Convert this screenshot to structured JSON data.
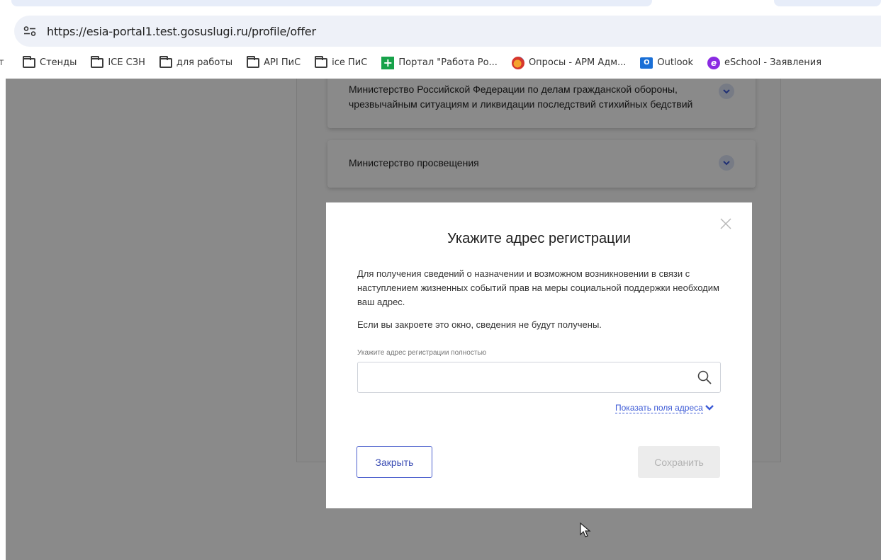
{
  "browser": {
    "url": "https://esia-portal1.test.gosuslugi.ru/profile/offer",
    "site_info_icon": "tune-icon",
    "bookmarks": [
      {
        "label": "Стенды",
        "icon": "folder-icon"
      },
      {
        "label": "ICE СЗН",
        "icon": "folder-icon"
      },
      {
        "label": "для работы",
        "icon": "folder-icon"
      },
      {
        "label": "API ПиС",
        "icon": "folder-icon"
      },
      {
        "label": "ice ПиС",
        "icon": "folder-icon"
      },
      {
        "label": "Портал \"Работа Ро...",
        "icon": "plus-favicon-icon"
      },
      {
        "label": "Опросы - АРМ Адм...",
        "icon": "poll-favicon-icon"
      },
      {
        "label": "Outlook",
        "icon": "outlook-icon"
      },
      {
        "label": "eSchool - Заявления",
        "icon": "eschool-icon"
      }
    ]
  },
  "page": {
    "accordion": [
      {
        "label": "Министерство Российской Федерации по делам гражданской обороны, чрезвычайным ситуациям и ликвидации последствий стихийных бедствий"
      },
      {
        "label": "Министерство просвещения"
      }
    ]
  },
  "modal": {
    "title": "Укажите адрес регистрации",
    "description": "Для получения сведений о назначении и возможном возникновении в связи с наступлением жизненных событий прав на меры социальной поддержки необходим ваш адрес.",
    "note": "Если вы закроете это окно, сведения не будут получены.",
    "field_label": "Укажите адрес регистрации полностью",
    "address_value": "",
    "address_placeholder": "",
    "show_fields_link": "Показать поля адреса",
    "close_button": "Закрыть",
    "save_button": "Сохранить"
  },
  "colors": {
    "accent": "#3c5ad6",
    "overlay": "#000000",
    "disabled_bg": "#ececec"
  }
}
